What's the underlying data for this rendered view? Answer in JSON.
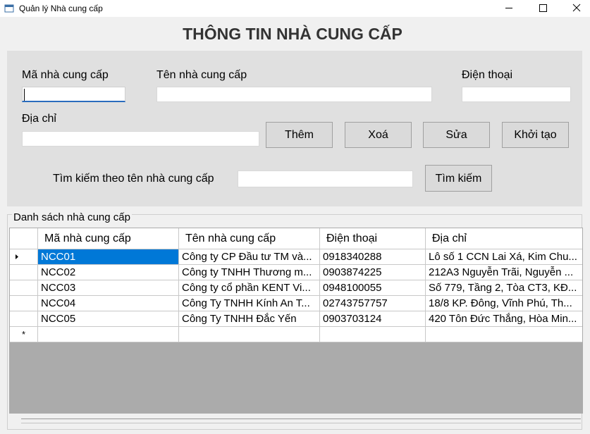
{
  "window": {
    "title": "Quản lý Nhà cung cấp",
    "minimize_icon": "minimize-icon",
    "maximize_icon": "maximize-icon",
    "close_icon": "close-icon"
  },
  "heading": "THÔNG TIN NHÀ CUNG CẤP",
  "form": {
    "code_label": "Mã nhà cung cấp",
    "code_value": "",
    "name_label": "Tên nhà cung cấp",
    "name_value": "",
    "phone_label": "Điện thoại",
    "phone_value": "",
    "address_label": "Địa chỉ",
    "address_value": "",
    "search_label": "Tìm kiếm theo tên nhà cung cấp",
    "search_value": ""
  },
  "buttons": {
    "add": "Thêm",
    "delete": "Xoá",
    "edit": "Sửa",
    "reset": "Khởi tạo",
    "search": "Tìm kiếm"
  },
  "grid": {
    "caption": "Danh sách nhà cung cấp",
    "columns": [
      "Mã nhà cung cấp",
      "Tên nhà cung cấp",
      "Điện thoại",
      "Địa chỉ"
    ],
    "rows": [
      [
        "NCC01",
        "Công ty CP Đầu tư TM và...",
        "0918340288",
        "Lô số 1 CCN Lai Xá, Kim Chu..."
      ],
      [
        "NCC02",
        "Công ty TNHH Thương m...",
        "0903874225",
        "212A3 Nguyễn Trãi, Nguyễn ..."
      ],
      [
        "NCC03",
        "Công ty cổ phần KENT Vi...",
        "0948100055",
        "Số 779, Tầng 2, Tòa CT3, KĐ..."
      ],
      [
        "NCC04",
        "Công Ty TNHH Kính An T...",
        "02743757757",
        "18/8 KP. Đông, Vĩnh Phú, Th..."
      ],
      [
        "NCC05",
        "Công Ty TNHH Đắc Yến",
        "0903703124",
        "420 Tôn Đức Thắng, Hòa Min..."
      ]
    ],
    "new_row_marker": "*",
    "selected_row": 0,
    "current_row_marker_icon": "row-pointer-icon",
    "colors": {
      "selection": "#0078d7",
      "background": "#ababab"
    }
  }
}
